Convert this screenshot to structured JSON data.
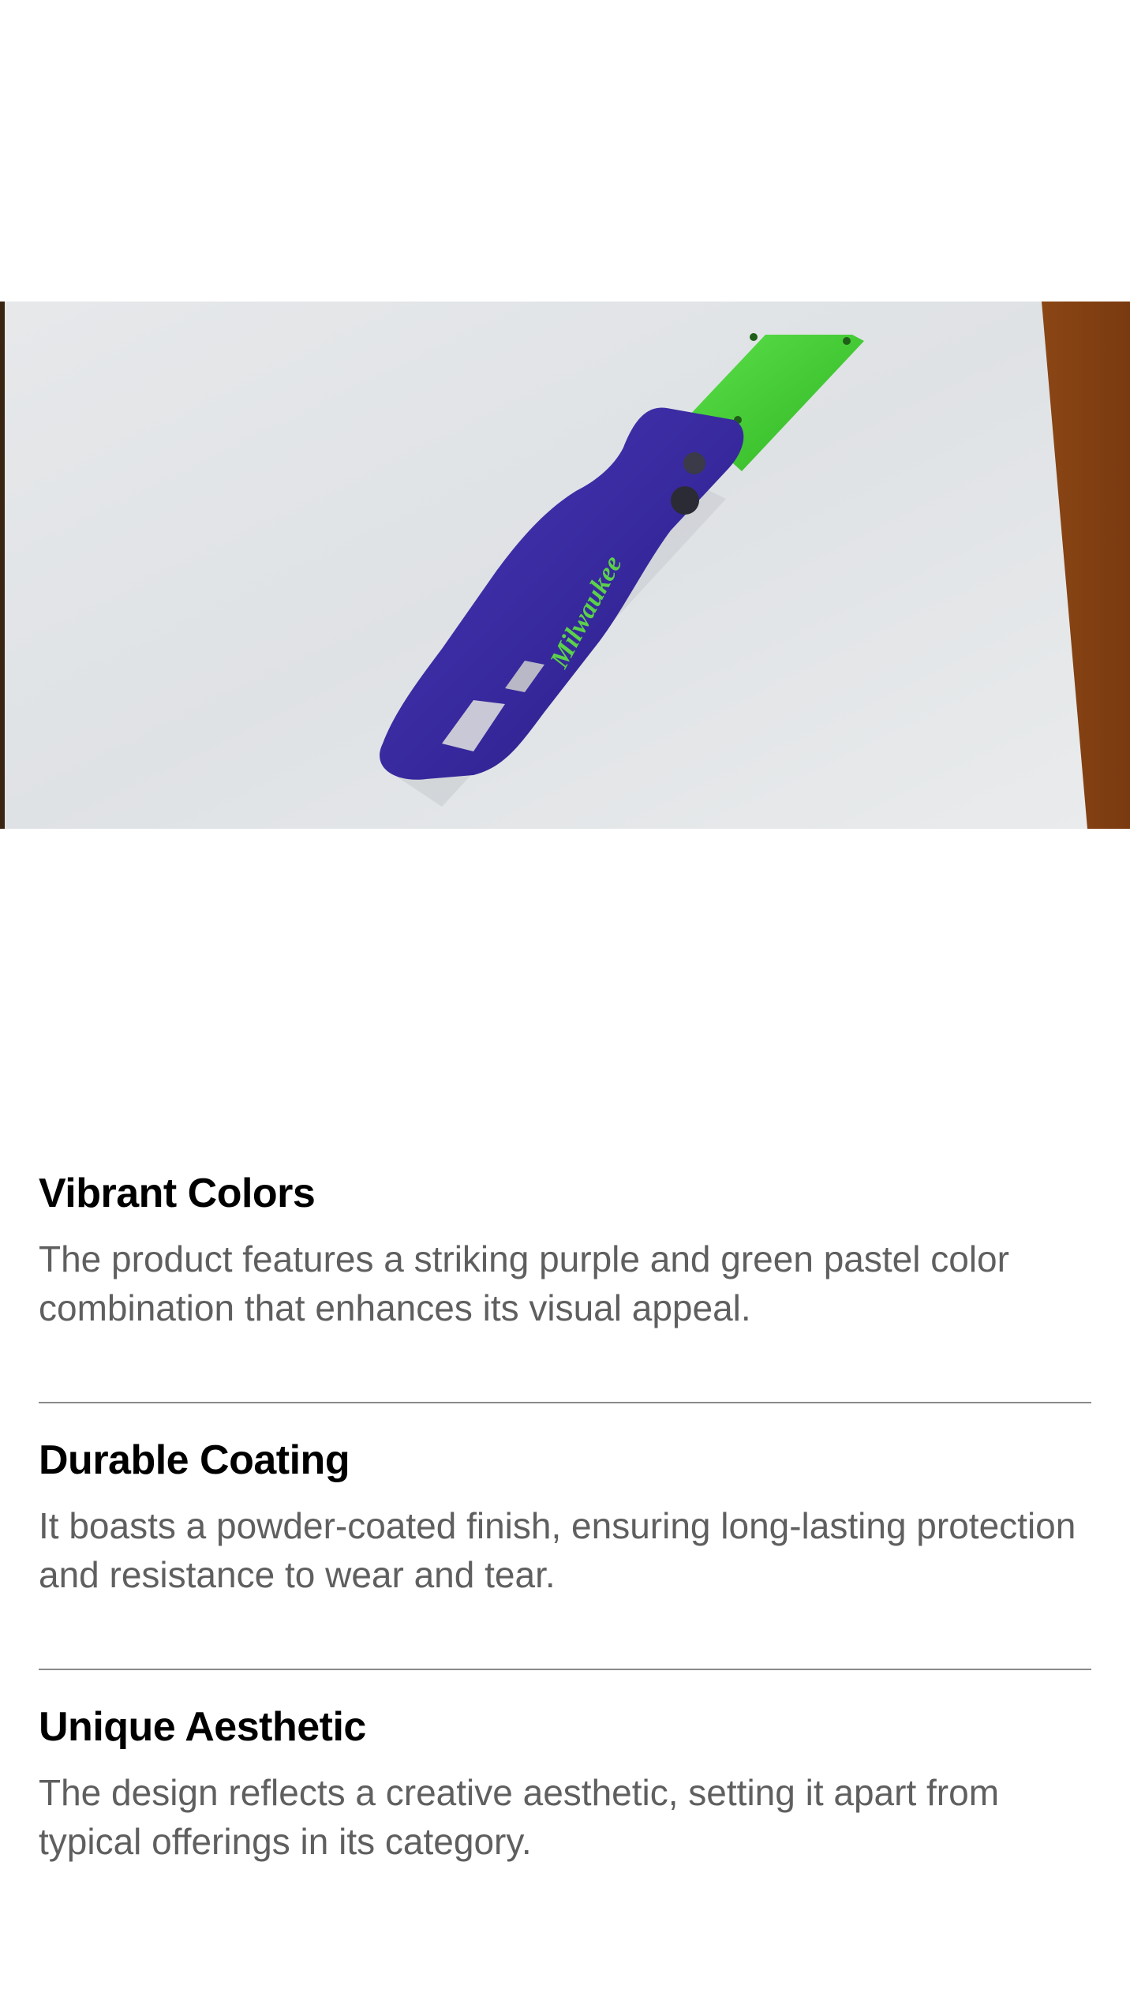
{
  "hero": {
    "image_description_icon": "utility-knife-photo",
    "colors": {
      "handle": "#3b2aa0",
      "blade": "#3fcf2e",
      "paper": "#e3e6e8",
      "wood": "#a8561c"
    }
  },
  "features": [
    {
      "title": "Vibrant Colors",
      "description": "The product features a striking purple and green pastel color combination that enhances its visual appeal."
    },
    {
      "title": "Durable Coating",
      "description": "It boasts a powder-coated finish, ensuring long-lasting protection and resistance to wear and tear."
    },
    {
      "title": "Unique Aesthetic",
      "description": "The design reflects a creative aesthetic, setting it apart from typical offerings in its category."
    }
  ]
}
